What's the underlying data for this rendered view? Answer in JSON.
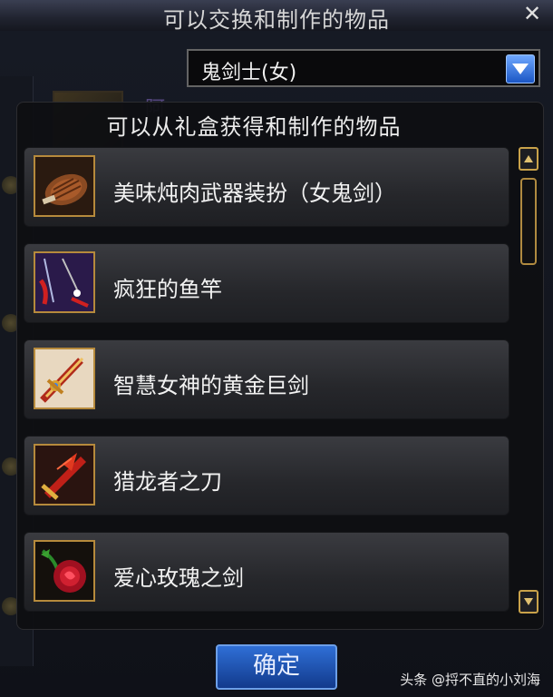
{
  "window": {
    "title": "可以交换和制作的物品",
    "close_glyph": "✕"
  },
  "background": {
    "partial_text": "阿"
  },
  "class_select": {
    "selected": "鬼剑士(女)"
  },
  "popup": {
    "title": "可以从礼盒获得和制作的物品",
    "items": [
      {
        "label": "美味炖肉武器装扮（女鬼剑）",
        "icon": "stew-meat-icon"
      },
      {
        "label": "疯狂的鱼竿",
        "icon": "fishing-rod-icon"
      },
      {
        "label": "智慧女神的黄金巨剑",
        "icon": "golden-greatsword-icon"
      },
      {
        "label": "猎龙者之刀",
        "icon": "dragon-hunter-blade-icon"
      },
      {
        "label": "爱心玫瑰之剑",
        "icon": "rose-sword-icon"
      }
    ]
  },
  "confirm_label": "确定",
  "watermark": "头条 @捋不直的小刘海",
  "colors": {
    "accent_gold": "#b68a3c",
    "button_blue": "#2f6fd6"
  }
}
